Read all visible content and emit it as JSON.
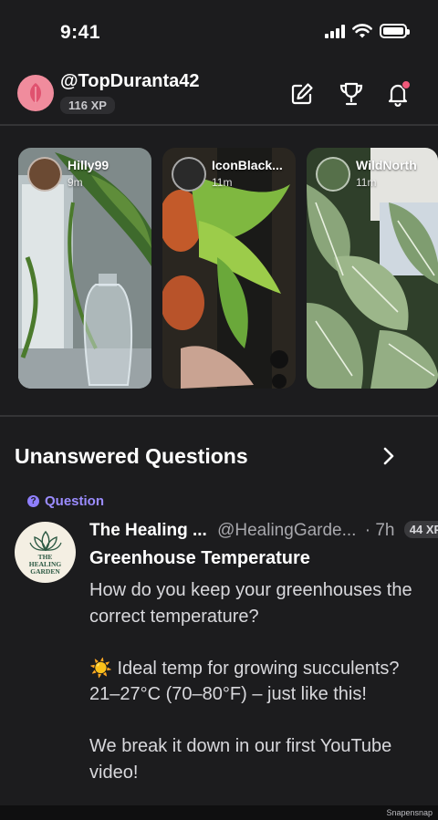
{
  "status_bar": {
    "time": "9:41"
  },
  "header": {
    "username": "@TopDuranta42",
    "xp": "116 XP",
    "icons": [
      "edit-icon",
      "trophy-icon",
      "bell-icon"
    ]
  },
  "stories": [
    {
      "name": "Hilly99",
      "time": "9m"
    },
    {
      "name": "IconBlack...",
      "time": "11m"
    },
    {
      "name": "WildNorth",
      "time": "11m"
    }
  ],
  "section": {
    "title": "Unanswered Questions"
  },
  "post": {
    "tag": "Question",
    "avatar_logo_line1": "THE",
    "avatar_logo_line2": "HEALING",
    "avatar_logo_line3": "GARDEN",
    "author": "The Healing ...",
    "handle": "@HealingGarde...",
    "time": "· 7h",
    "xp": "44 XP",
    "title": "Greenhouse Temperature",
    "body": {
      "line1": "How do you keep your greenhouses the correct temperature?",
      "line2_emoji": "☀️",
      "line2": "Ideal temp for growing succulents?",
      "line3": "21–27°C (70–80°F) – just like this!",
      "line4": "We break it down in our first YouTube video!"
    }
  },
  "watermark": "Snapensnap",
  "colors": {
    "background": "#1c1c1e",
    "accent_purple": "#9b8cff",
    "notification": "#f0597a",
    "avatar_pink": "#f08c9d"
  }
}
